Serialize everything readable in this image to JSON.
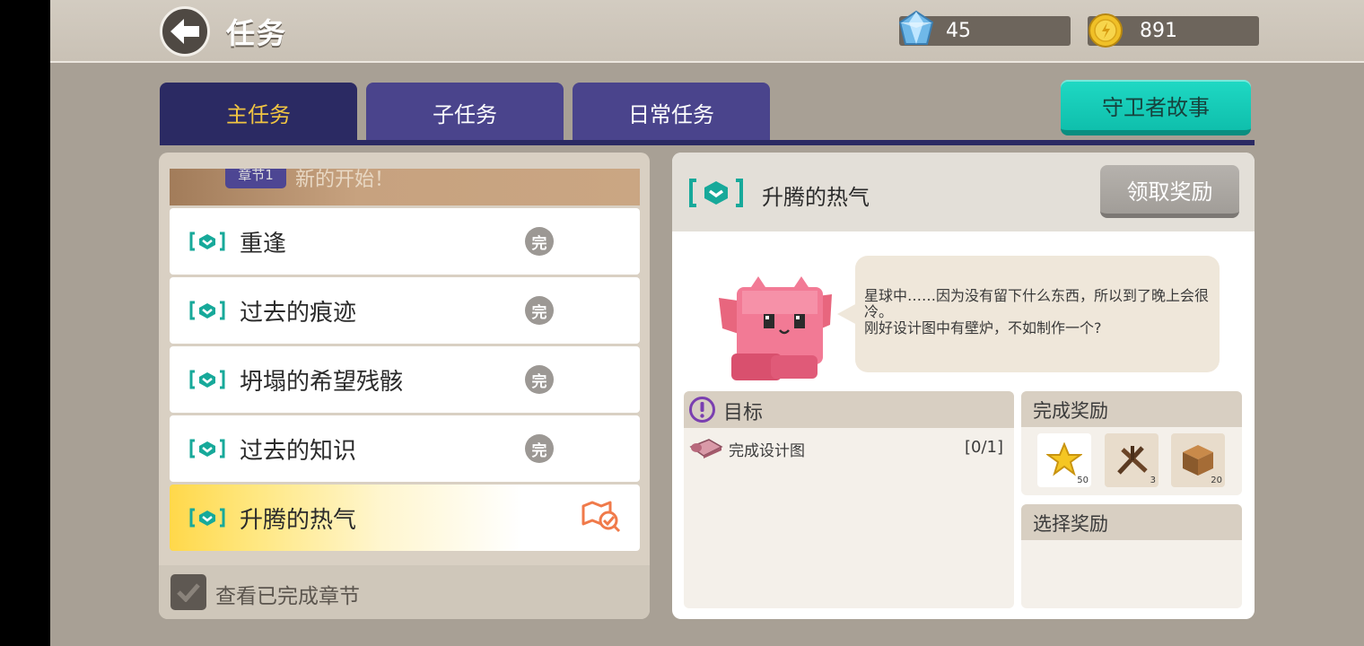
{
  "header": {
    "title": "任务",
    "gems": "45",
    "coins": "891"
  },
  "tabs": [
    {
      "label": "主任务",
      "active": true
    },
    {
      "label": "子任务",
      "active": false
    },
    {
      "label": "日常任务",
      "active": false
    }
  ],
  "guardian_button": "守卫者故事",
  "chapter": {
    "badge": "章节1",
    "name": "新的开始！"
  },
  "quests": [
    {
      "name": "重逢",
      "status": "完"
    },
    {
      "name": "过去的痕迹",
      "status": "完"
    },
    {
      "name": "坍塌的希望残骸",
      "status": "完"
    },
    {
      "name": "过去的知识",
      "status": "完"
    },
    {
      "name": "升腾的热气",
      "status": "tracking"
    }
  ],
  "footer": {
    "show_completed_label": "查看已完成章节",
    "checked": true
  },
  "detail": {
    "title": "升腾的热气",
    "claim_button": "领取奖励",
    "dialogue_line1": "星球中……因为没有留下什么东西，所以到了晚上会很冷。",
    "dialogue_line2": "刚好设计图中有壁炉，不如制作一个?",
    "goal_header": "目标",
    "goal_text": "完成设计图",
    "goal_count": "[0/1]",
    "reward_header": "完成奖励",
    "rewards": [
      {
        "icon": "star-icon",
        "count": "50"
      },
      {
        "icon": "wood-stick-icon",
        "count": "3"
      },
      {
        "icon": "wood-block-icon",
        "count": "20"
      }
    ],
    "choose_header": "选择奖励"
  },
  "colors": {
    "accent_tab": "#2b2a63",
    "tab_inactive": "#4a448c",
    "teal": "#0fbfac",
    "gold_text": "#f1c542"
  }
}
